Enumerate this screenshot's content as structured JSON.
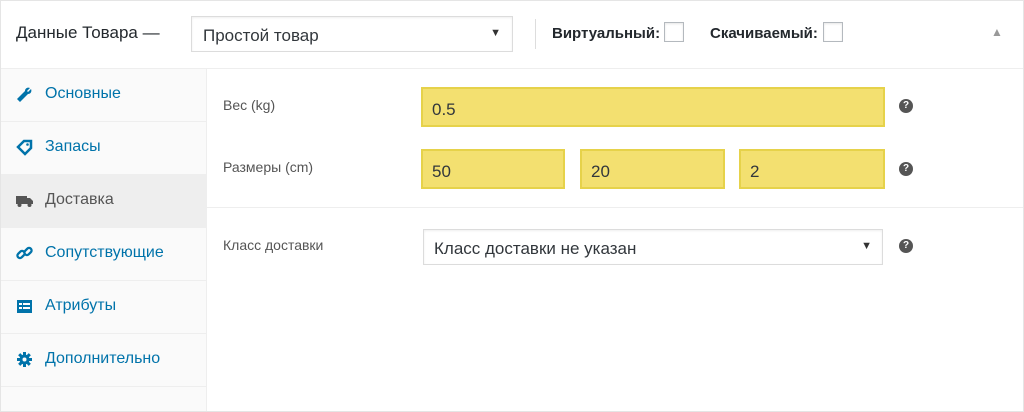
{
  "header": {
    "title": "Данные Товара —",
    "product_type": "Простой товар",
    "virtual_label": "Виртуальный:",
    "downloadable_label": "Скачиваемый:",
    "collapse_glyph": "▲"
  },
  "sidebar": {
    "items": [
      {
        "label": "Основные",
        "icon": "wrench-icon"
      },
      {
        "label": "Запасы",
        "icon": "tag-icon"
      },
      {
        "label": "Доставка",
        "icon": "truck-icon",
        "active": true
      },
      {
        "label": "Сопутствующие",
        "icon": "link-icon"
      },
      {
        "label": "Атрибуты",
        "icon": "list-icon"
      },
      {
        "label": "Дополнительно",
        "icon": "gear-icon"
      }
    ]
  },
  "shipping": {
    "weight_label": "Вес (kg)",
    "weight_value": "0.5",
    "dimensions_label": "Размеры (cm)",
    "length": "50",
    "width": "20",
    "height": "2",
    "class_label": "Класс доставки",
    "class_value": "Класс доставки не указан",
    "help_glyph": "?"
  },
  "colors": {
    "accent": "#0073aa",
    "highlight_fill": "#f3e070",
    "highlight_border": "#e6d24a"
  }
}
